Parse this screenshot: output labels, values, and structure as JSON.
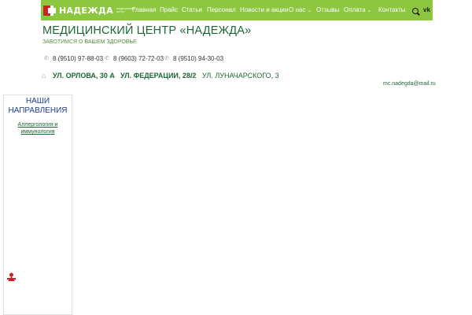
{
  "header": {
    "logo_text": "НАДЕЖДА",
    "logo_sub": "медицинский центр",
    "nav": [
      {
        "label": "Главная"
      },
      {
        "label": "Прайс"
      },
      {
        "label": "Статьи"
      },
      {
        "label": "Персонал"
      },
      {
        "label": "Новости и акции"
      },
      {
        "label": "О нас",
        "dropdown": true
      },
      {
        "label": "Отзывы"
      },
      {
        "label": "Оплата",
        "dropdown": true
      },
      {
        "label": "Контакты"
      }
    ],
    "icons": {
      "search": "search-icon",
      "social": "vk-icon"
    },
    "vk_label": "vk"
  },
  "site": {
    "title": "МЕДИЦИНСКИЙ ЦЕНТР «НАДЕЖДА»",
    "tagline": "ЗАБОТИМСЯ О ВАШЕМ ЗДОРОВЬЕ",
    "phones": [
      "8 (9510) 97-88-03",
      "8 (9603) 72-72-03",
      "8 (9510) 94-30-03"
    ],
    "addresses": [
      "УЛ. ОРЛОВА, 30 А",
      "УЛ. ФЕДЕРАЦИИ, 28/2",
      "УЛ. ЛУНАЧАРСКОГО, 3"
    ],
    "email": "mc.nadegda@mail.ru"
  },
  "sidebar": {
    "heading_line1": "НАШИ",
    "heading_line2": "НАПРАВЛЕНИЯ",
    "link_line1": "Аллергология и",
    "link_line2": "иммунология"
  },
  "colors": {
    "accent": "#8dc63f",
    "brand_green": "#1d6638",
    "logo_red": "#d21e2b"
  }
}
